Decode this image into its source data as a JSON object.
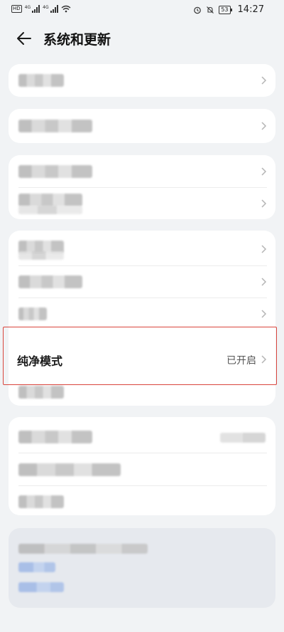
{
  "status_bar": {
    "hd_label": "HD",
    "sim1_tag": "4G",
    "sim2_tag": "4G",
    "battery": "53",
    "time": "14:27"
  },
  "header": {
    "title": "系统和更新",
    "back_icon": "back-arrow-icon"
  },
  "pure_mode": {
    "label": "纯净模式",
    "status": "已开启"
  },
  "colors": {
    "background": "#f1f3f5",
    "card": "#ffffff",
    "highlight_border": "#d9453d"
  }
}
